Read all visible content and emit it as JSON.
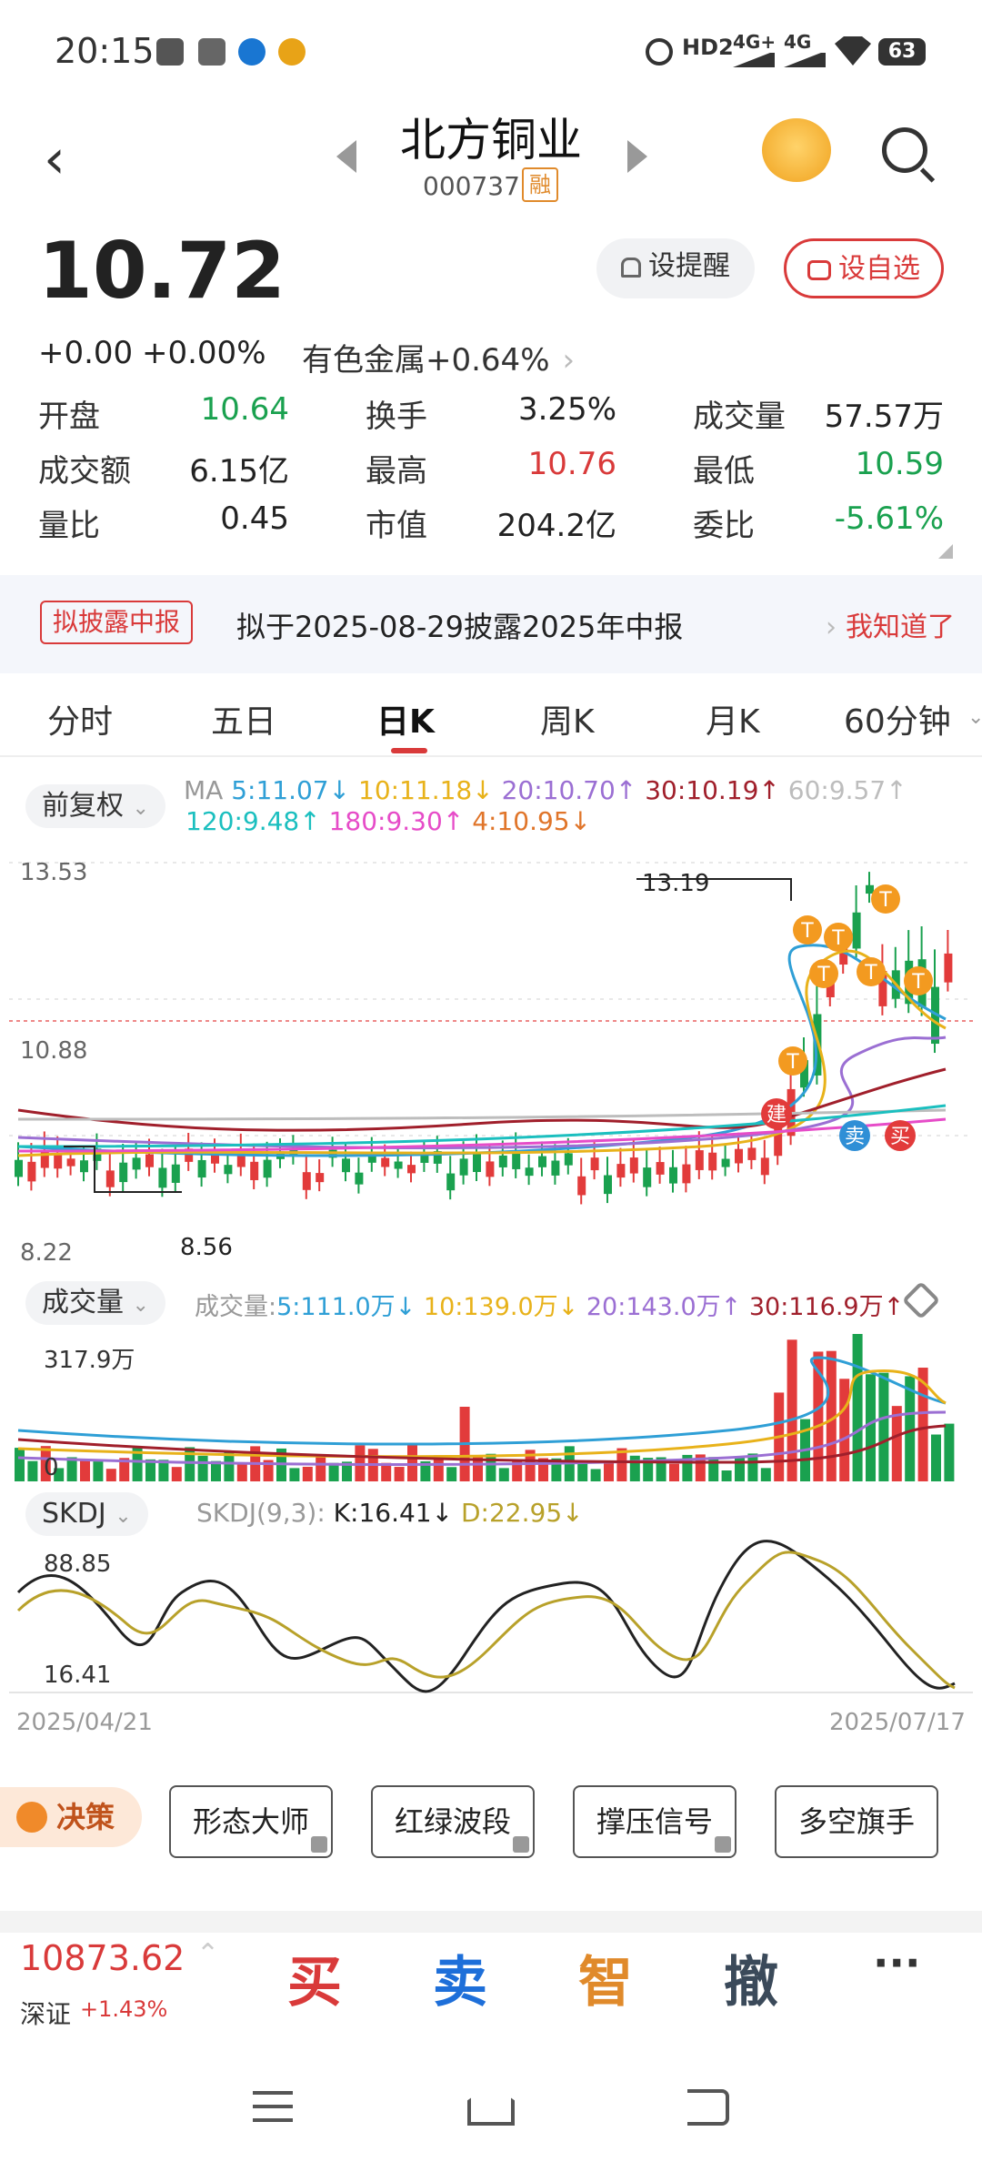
{
  "status": {
    "time": "20:15",
    "battery": "63",
    "network_a": "4G+",
    "network_b": "4G",
    "hd": "HD2"
  },
  "header": {
    "name": "北方铜业",
    "code": "000737",
    "badge": "融"
  },
  "quote": {
    "price": "10.72",
    "change": "+0.00",
    "change_pct": "+0.00%",
    "sector": "有色金属",
    "sector_pct": "+0.64%",
    "alert_btn": "设提醒",
    "watch_btn": "设自选",
    "stats": [
      {
        "label": "开盘",
        "value": "10.64",
        "color": "#1aa14f"
      },
      {
        "label": "换手",
        "value": "3.25%",
        "color": "#222222"
      },
      {
        "label": "成交量",
        "value": "57.57万",
        "color": "#222222"
      },
      {
        "label": "成交额",
        "value": "6.15亿",
        "color": "#222222"
      },
      {
        "label": "最高",
        "value": "10.76",
        "color": "#d93a3a"
      },
      {
        "label": "最低",
        "value": "10.59",
        "color": "#1aa14f"
      },
      {
        "label": "量比",
        "value": "0.45",
        "color": "#222222"
      },
      {
        "label": "市值",
        "value": "204.2亿",
        "color": "#222222"
      },
      {
        "label": "委比",
        "value": "-5.61%",
        "color": "#1aa14f"
      }
    ]
  },
  "notice": {
    "tag": "拟披露中报",
    "text": "拟于2025-08-29披露2025年中报",
    "btn": "我知道了"
  },
  "tabs": [
    "分时",
    "五日",
    "日K",
    "周K",
    "月K",
    "60分钟"
  ],
  "chart": {
    "adjust": "前复权",
    "ma_label": "MA",
    "ma": [
      {
        "text": "5:11.07↓",
        "color": "#2f9fd6"
      },
      {
        "text": "10:11.18↓",
        "color": "#e8b21a"
      },
      {
        "text": "20:10.70↑",
        "color": "#9b6fd3"
      },
      {
        "text": "30:10.19↑",
        "color": "#a01f2b"
      },
      {
        "text": "60:9.57↑",
        "color": "#bdbdbd"
      },
      {
        "text": "120:9.48↑",
        "color": "#1bbfbf"
      },
      {
        "text": "180:9.30↑",
        "color": "#e64cc8"
      },
      {
        "text": "4:10.95↓",
        "color": "#e0752a"
      }
    ],
    "y_top": "13.53",
    "y_mid": "10.88",
    "y_bottom": "8.22",
    "high_label": "13.19",
    "low_label": "8.56",
    "vol_title": "成交量",
    "vol_prefix": "成交量:",
    "vol_ma": [
      {
        "text": "5:111.0万↓",
        "color": "#2f9fd6"
      },
      {
        "text": "10:139.0万↓",
        "color": "#e8b21a"
      },
      {
        "text": "20:143.0万↑",
        "color": "#9b6fd3"
      },
      {
        "text": "30:116.9万↑",
        "color": "#a01f2b"
      }
    ],
    "vol_max": "317.9万",
    "vol_zero": "0",
    "ind_title": "SKDJ",
    "ind_prefix": "SKDJ(9,3):",
    "ind_k": "K:16.41↓",
    "ind_d": "D:22.95↓",
    "ind_top": "88.85",
    "ind_bottom": "16.41",
    "date_start": "2025/04/21",
    "date_end": "2025/07/17",
    "marks": {
      "t": "T",
      "jian": "建",
      "mai": "卖",
      "buy": "买"
    }
  },
  "actions": {
    "decision": "决策",
    "buttons": [
      "形态大师",
      "红绿波段",
      "撑压信号",
      "多空旗手"
    ]
  },
  "bottom": {
    "index_value": "10873.62",
    "index_name": "深证",
    "index_pct": "+1.43%",
    "buy": "买",
    "sell": "卖",
    "smart": "智",
    "cancel": "撤",
    "more": "···"
  }
}
